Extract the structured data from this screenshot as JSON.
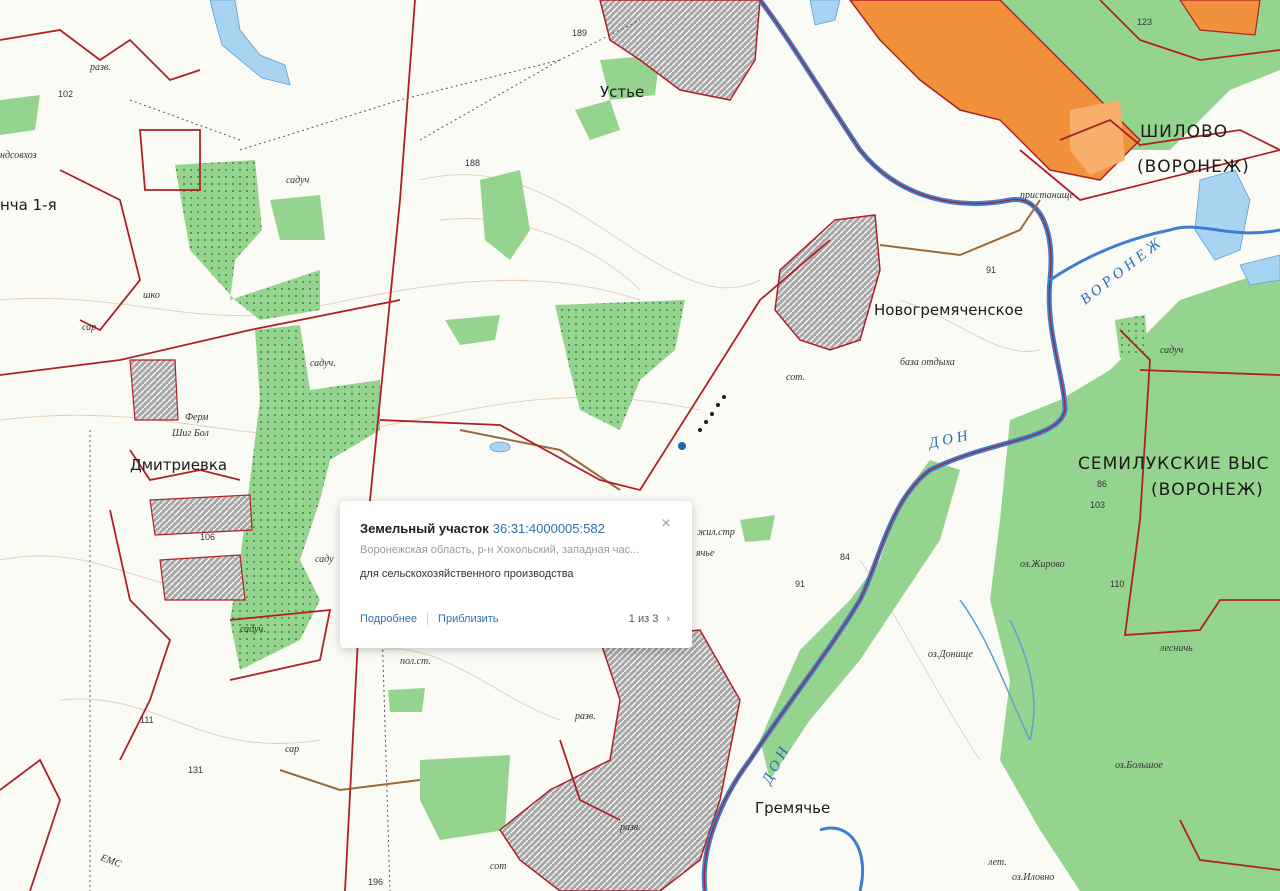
{
  "map": {
    "places": {
      "ustye": "Устье",
      "shilovo": "ШИЛОВО",
      "shilovo_sub": "(ВОРОНЕЖ)",
      "novogremyachenskoe": "Новогремяченское",
      "semiluk": "СЕМИЛУКСКИЕ  ВЫС",
      "semiluk_sub": "(ВОРОНЕЖ)",
      "dmitrievka": "Дмитриевка",
      "gremyache": "Гремячье",
      "oncha": "нча 1-я",
      "yachye": "ячье"
    },
    "rivers": {
      "voronezh": "ВОРОНЕЖ",
      "don_upper": "ДОН",
      "don_lower": "ДОН"
    },
    "small_labels": {
      "sadu1": "садуч",
      "sadu2": "садуч.",
      "sadu3": "садуч",
      "sadu4": "саду",
      "sadu5": "садуч.",
      "sadu6": "садуч",
      "sar1": "сар",
      "sar2": "сар",
      "sot1": "сот.",
      "sot2": "сот",
      "razv1": "разв.",
      "razv2": "разв.",
      "razv3": "разв.",
      "baza": "база отдыха",
      "zhilstr": "жил.стр",
      "polst": "пол.ст.",
      "oz_zhirovo": "оз.Жирово",
      "oz_donishche": "оз.Донище",
      "oz_bolshoe": "оз.Большое",
      "lesnich": "лесничь",
      "let": "лет.",
      "pristan": "пристанище",
      "oz_ilovno": "оз.Иловно",
      "shko": "шко",
      "ferma": "Ферм",
      "shig": "Шиг Бол",
      "hdsovhoz": "ндсовхоз",
      "emcha": "ЕМС"
    },
    "numbers": [
      "189",
      "188",
      "123",
      "91",
      "102",
      "86",
      "103",
      "110",
      "84",
      "131",
      "196",
      "91",
      "106",
      "111"
    ]
  },
  "popup": {
    "title": "Земельный участок",
    "cadastral": "36:31:4000005:582",
    "close_glyph": "×",
    "address": "Воронежская область, р-н Хохольский, западная час...",
    "usage": "для сельскохозяйственного производства",
    "link_details": "Подробнее",
    "link_zoom": "Приблизить",
    "pager": "1 из 3",
    "next_glyph": "›"
  },
  "colors": {
    "boundary": "#b02027",
    "forest": "#8fd08a",
    "water": "#a8d4f2",
    "river": "#2b6fbf",
    "town": "#9e9e9e",
    "city": "#f1913c",
    "link": "#2f6fb3"
  }
}
